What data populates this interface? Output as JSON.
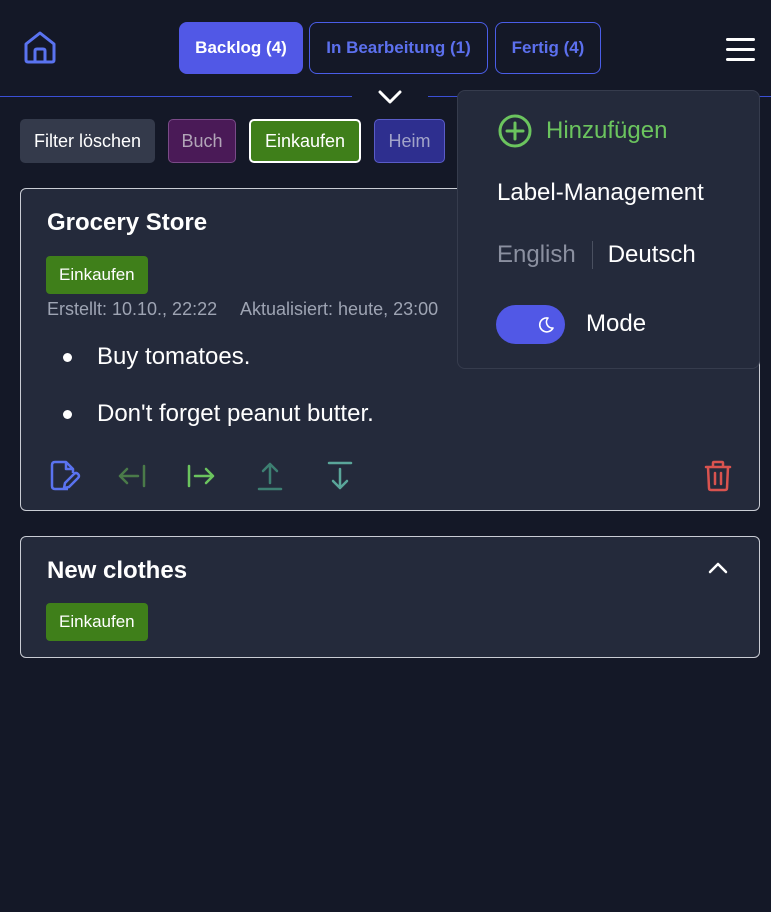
{
  "header": {
    "tabs": [
      {
        "label": "Backlog (4)",
        "active": true
      },
      {
        "label": "In Bearbeitung (1)",
        "active": false
      },
      {
        "label": "Fertig (4)",
        "active": false
      }
    ]
  },
  "filters": {
    "clear_label": "Filter löschen",
    "chips": [
      {
        "label": "Buch",
        "color": "#4a1a57",
        "selected": false
      },
      {
        "label": "Einkaufen",
        "color": "#3f7f1a",
        "selected": true
      },
      {
        "label": "Heim",
        "color": "#2e2f8f",
        "selected": false
      }
    ]
  },
  "cards": [
    {
      "title": "Grocery Store",
      "label": "Einkaufen",
      "created": "Erstellt: 10.10., 22:22",
      "updated": "Aktualisiert: heute, 23:00",
      "items": [
        "Buy tomatoes.",
        "Don't forget peanut butter."
      ],
      "actions": [
        "edit-icon",
        "move-left-icon",
        "move-right-icon",
        "move-top-icon",
        "move-bottom-icon",
        "delete-icon"
      ]
    },
    {
      "title": "New clothes",
      "label": "Einkaufen",
      "collapsed": true
    }
  ],
  "menu": {
    "add_label": "Hinzufügen",
    "label_management": "Label-Management",
    "lang_en": "English",
    "lang_de": "Deutsch",
    "active_language": "Deutsch",
    "mode_label": "Mode",
    "dark_mode": true
  },
  "colors": {
    "background": "#141827",
    "card": "#242a3b",
    "accent": "#5158e6",
    "label_green": "#3f7f1a",
    "delete": "#d9534f"
  }
}
